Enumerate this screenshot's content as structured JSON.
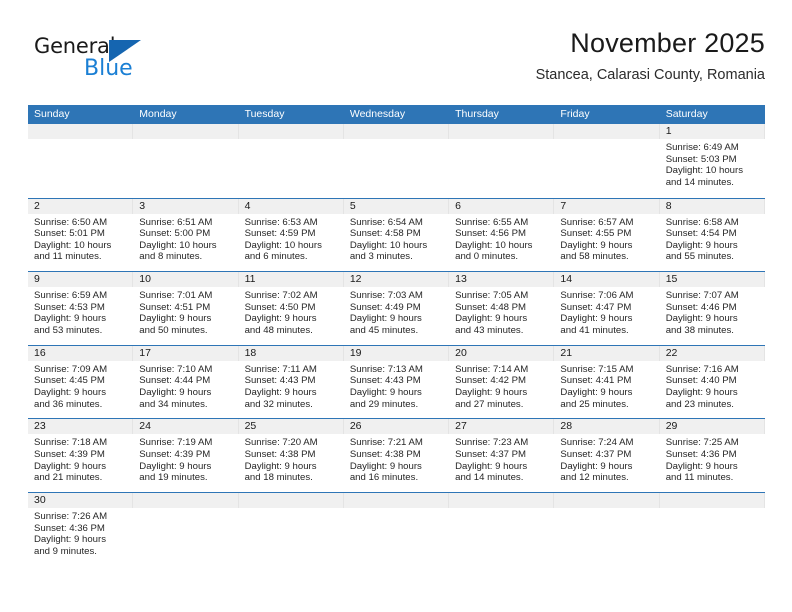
{
  "brand": {
    "name_top": "General",
    "name_bottom": "Blue",
    "flag_icon": "flag-triangle-icon",
    "color_dark": "#1a1a1a",
    "color_blue": "#1a7fd4"
  },
  "header": {
    "title": "November 2025",
    "subtitle": "Stancea, Calarasi County, Romania"
  },
  "theme": {
    "header_blue": "#2e75b6",
    "date_band_gray": "#f0f0f0",
    "cell_white": "#ffffff"
  },
  "weekdays": [
    "Sunday",
    "Monday",
    "Tuesday",
    "Wednesday",
    "Thursday",
    "Friday",
    "Saturday"
  ],
  "weeks": [
    [
      {
        "date": "",
        "sunrise": "",
        "sunset": "",
        "daylight_line1": "",
        "daylight_line2": ""
      },
      {
        "date": "",
        "sunrise": "",
        "sunset": "",
        "daylight_line1": "",
        "daylight_line2": ""
      },
      {
        "date": "",
        "sunrise": "",
        "sunset": "",
        "daylight_line1": "",
        "daylight_line2": ""
      },
      {
        "date": "",
        "sunrise": "",
        "sunset": "",
        "daylight_line1": "",
        "daylight_line2": ""
      },
      {
        "date": "",
        "sunrise": "",
        "sunset": "",
        "daylight_line1": "",
        "daylight_line2": ""
      },
      {
        "date": "",
        "sunrise": "",
        "sunset": "",
        "daylight_line1": "",
        "daylight_line2": ""
      },
      {
        "date": "1",
        "sunrise": "Sunrise: 6:49 AM",
        "sunset": "Sunset: 5:03 PM",
        "daylight_line1": "Daylight: 10 hours",
        "daylight_line2": "and 14 minutes."
      }
    ],
    [
      {
        "date": "2",
        "sunrise": "Sunrise: 6:50 AM",
        "sunset": "Sunset: 5:01 PM",
        "daylight_line1": "Daylight: 10 hours",
        "daylight_line2": "and 11 minutes."
      },
      {
        "date": "3",
        "sunrise": "Sunrise: 6:51 AM",
        "sunset": "Sunset: 5:00 PM",
        "daylight_line1": "Daylight: 10 hours",
        "daylight_line2": "and 8 minutes."
      },
      {
        "date": "4",
        "sunrise": "Sunrise: 6:53 AM",
        "sunset": "Sunset: 4:59 PM",
        "daylight_line1": "Daylight: 10 hours",
        "daylight_line2": "and 6 minutes."
      },
      {
        "date": "5",
        "sunrise": "Sunrise: 6:54 AM",
        "sunset": "Sunset: 4:58 PM",
        "daylight_line1": "Daylight: 10 hours",
        "daylight_line2": "and 3 minutes."
      },
      {
        "date": "6",
        "sunrise": "Sunrise: 6:55 AM",
        "sunset": "Sunset: 4:56 PM",
        "daylight_line1": "Daylight: 10 hours",
        "daylight_line2": "and 0 minutes."
      },
      {
        "date": "7",
        "sunrise": "Sunrise: 6:57 AM",
        "sunset": "Sunset: 4:55 PM",
        "daylight_line1": "Daylight: 9 hours",
        "daylight_line2": "and 58 minutes."
      },
      {
        "date": "8",
        "sunrise": "Sunrise: 6:58 AM",
        "sunset": "Sunset: 4:54 PM",
        "daylight_line1": "Daylight: 9 hours",
        "daylight_line2": "and 55 minutes."
      }
    ],
    [
      {
        "date": "9",
        "sunrise": "Sunrise: 6:59 AM",
        "sunset": "Sunset: 4:53 PM",
        "daylight_line1": "Daylight: 9 hours",
        "daylight_line2": "and 53 minutes."
      },
      {
        "date": "10",
        "sunrise": "Sunrise: 7:01 AM",
        "sunset": "Sunset: 4:51 PM",
        "daylight_line1": "Daylight: 9 hours",
        "daylight_line2": "and 50 minutes."
      },
      {
        "date": "11",
        "sunrise": "Sunrise: 7:02 AM",
        "sunset": "Sunset: 4:50 PM",
        "daylight_line1": "Daylight: 9 hours",
        "daylight_line2": "and 48 minutes."
      },
      {
        "date": "12",
        "sunrise": "Sunrise: 7:03 AM",
        "sunset": "Sunset: 4:49 PM",
        "daylight_line1": "Daylight: 9 hours",
        "daylight_line2": "and 45 minutes."
      },
      {
        "date": "13",
        "sunrise": "Sunrise: 7:05 AM",
        "sunset": "Sunset: 4:48 PM",
        "daylight_line1": "Daylight: 9 hours",
        "daylight_line2": "and 43 minutes."
      },
      {
        "date": "14",
        "sunrise": "Sunrise: 7:06 AM",
        "sunset": "Sunset: 4:47 PM",
        "daylight_line1": "Daylight: 9 hours",
        "daylight_line2": "and 41 minutes."
      },
      {
        "date": "15",
        "sunrise": "Sunrise: 7:07 AM",
        "sunset": "Sunset: 4:46 PM",
        "daylight_line1": "Daylight: 9 hours",
        "daylight_line2": "and 38 minutes."
      }
    ],
    [
      {
        "date": "16",
        "sunrise": "Sunrise: 7:09 AM",
        "sunset": "Sunset: 4:45 PM",
        "daylight_line1": "Daylight: 9 hours",
        "daylight_line2": "and 36 minutes."
      },
      {
        "date": "17",
        "sunrise": "Sunrise: 7:10 AM",
        "sunset": "Sunset: 4:44 PM",
        "daylight_line1": "Daylight: 9 hours",
        "daylight_line2": "and 34 minutes."
      },
      {
        "date": "18",
        "sunrise": "Sunrise: 7:11 AM",
        "sunset": "Sunset: 4:43 PM",
        "daylight_line1": "Daylight: 9 hours",
        "daylight_line2": "and 32 minutes."
      },
      {
        "date": "19",
        "sunrise": "Sunrise: 7:13 AM",
        "sunset": "Sunset: 4:43 PM",
        "daylight_line1": "Daylight: 9 hours",
        "daylight_line2": "and 29 minutes."
      },
      {
        "date": "20",
        "sunrise": "Sunrise: 7:14 AM",
        "sunset": "Sunset: 4:42 PM",
        "daylight_line1": "Daylight: 9 hours",
        "daylight_line2": "and 27 minutes."
      },
      {
        "date": "21",
        "sunrise": "Sunrise: 7:15 AM",
        "sunset": "Sunset: 4:41 PM",
        "daylight_line1": "Daylight: 9 hours",
        "daylight_line2": "and 25 minutes."
      },
      {
        "date": "22",
        "sunrise": "Sunrise: 7:16 AM",
        "sunset": "Sunset: 4:40 PM",
        "daylight_line1": "Daylight: 9 hours",
        "daylight_line2": "and 23 minutes."
      }
    ],
    [
      {
        "date": "23",
        "sunrise": "Sunrise: 7:18 AM",
        "sunset": "Sunset: 4:39 PM",
        "daylight_line1": "Daylight: 9 hours",
        "daylight_line2": "and 21 minutes."
      },
      {
        "date": "24",
        "sunrise": "Sunrise: 7:19 AM",
        "sunset": "Sunset: 4:39 PM",
        "daylight_line1": "Daylight: 9 hours",
        "daylight_line2": "and 19 minutes."
      },
      {
        "date": "25",
        "sunrise": "Sunrise: 7:20 AM",
        "sunset": "Sunset: 4:38 PM",
        "daylight_line1": "Daylight: 9 hours",
        "daylight_line2": "and 18 minutes."
      },
      {
        "date": "26",
        "sunrise": "Sunrise: 7:21 AM",
        "sunset": "Sunset: 4:38 PM",
        "daylight_line1": "Daylight: 9 hours",
        "daylight_line2": "and 16 minutes."
      },
      {
        "date": "27",
        "sunrise": "Sunrise: 7:23 AM",
        "sunset": "Sunset: 4:37 PM",
        "daylight_line1": "Daylight: 9 hours",
        "daylight_line2": "and 14 minutes."
      },
      {
        "date": "28",
        "sunrise": "Sunrise: 7:24 AM",
        "sunset": "Sunset: 4:37 PM",
        "daylight_line1": "Daylight: 9 hours",
        "daylight_line2": "and 12 minutes."
      },
      {
        "date": "29",
        "sunrise": "Sunrise: 7:25 AM",
        "sunset": "Sunset: 4:36 PM",
        "daylight_line1": "Daylight: 9 hours",
        "daylight_line2": "and 11 minutes."
      }
    ],
    [
      {
        "date": "30",
        "sunrise": "Sunrise: 7:26 AM",
        "sunset": "Sunset: 4:36 PM",
        "daylight_line1": "Daylight: 9 hours",
        "daylight_line2": "and 9 minutes."
      },
      {
        "date": "",
        "sunrise": "",
        "sunset": "",
        "daylight_line1": "",
        "daylight_line2": ""
      },
      {
        "date": "",
        "sunrise": "",
        "sunset": "",
        "daylight_line1": "",
        "daylight_line2": ""
      },
      {
        "date": "",
        "sunrise": "",
        "sunset": "",
        "daylight_line1": "",
        "daylight_line2": ""
      },
      {
        "date": "",
        "sunrise": "",
        "sunset": "",
        "daylight_line1": "",
        "daylight_line2": ""
      },
      {
        "date": "",
        "sunrise": "",
        "sunset": "",
        "daylight_line1": "",
        "daylight_line2": ""
      },
      {
        "date": "",
        "sunrise": "",
        "sunset": "",
        "daylight_line1": "",
        "daylight_line2": ""
      }
    ]
  ]
}
